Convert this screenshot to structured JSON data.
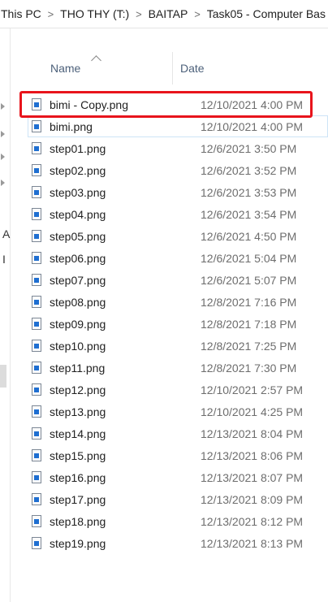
{
  "breadcrumb": [
    {
      "label": "This PC"
    },
    {
      "label": "THO THY (T:)"
    },
    {
      "label": "BAITAP"
    },
    {
      "label": "Task05 - Computer Bas"
    }
  ],
  "separator": ">",
  "nav_fragments": {
    "letter_a": "A",
    "letter_b": "I"
  },
  "columns": {
    "name": "Name",
    "date": "Date"
  },
  "files": [
    {
      "name": "bimi - Copy.png",
      "date": "12/10/2021 4:00 PM"
    },
    {
      "name": "bimi.png",
      "date": "12/10/2021 4:00 PM"
    },
    {
      "name": "step01.png",
      "date": "12/6/2021 3:50 PM"
    },
    {
      "name": "step02.png",
      "date": "12/6/2021 3:52 PM"
    },
    {
      "name": "step03.png",
      "date": "12/6/2021 3:53 PM"
    },
    {
      "name": "step04.png",
      "date": "12/6/2021 3:54 PM"
    },
    {
      "name": "step05.png",
      "date": "12/6/2021 4:50 PM"
    },
    {
      "name": "step06.png",
      "date": "12/6/2021 5:04 PM"
    },
    {
      "name": "step07.png",
      "date": "12/6/2021 5:07 PM"
    },
    {
      "name": "step08.png",
      "date": "12/8/2021 7:16 PM"
    },
    {
      "name": "step09.png",
      "date": "12/8/2021 7:18 PM"
    },
    {
      "name": "step10.png",
      "date": "12/8/2021 7:25 PM"
    },
    {
      "name": "step11.png",
      "date": "12/8/2021 7:30 PM"
    },
    {
      "name": "step12.png",
      "date": "12/10/2021 2:57 PM"
    },
    {
      "name": "step13.png",
      "date": "12/10/2021 4:25 PM"
    },
    {
      "name": "step14.png",
      "date": "12/13/2021 8:04 PM"
    },
    {
      "name": "step15.png",
      "date": "12/13/2021 8:06 PM"
    },
    {
      "name": "step16.png",
      "date": "12/13/2021 8:07 PM"
    },
    {
      "name": "step17.png",
      "date": "12/13/2021 8:09 PM"
    },
    {
      "name": "step18.png",
      "date": "12/13/2021 8:12 PM"
    },
    {
      "name": "step19.png",
      "date": "12/13/2021 8:13 PM"
    }
  ],
  "colors": {
    "highlight": "#e8141c",
    "icon_accent": "#1f6fd1",
    "header_text": "#4c607a"
  }
}
